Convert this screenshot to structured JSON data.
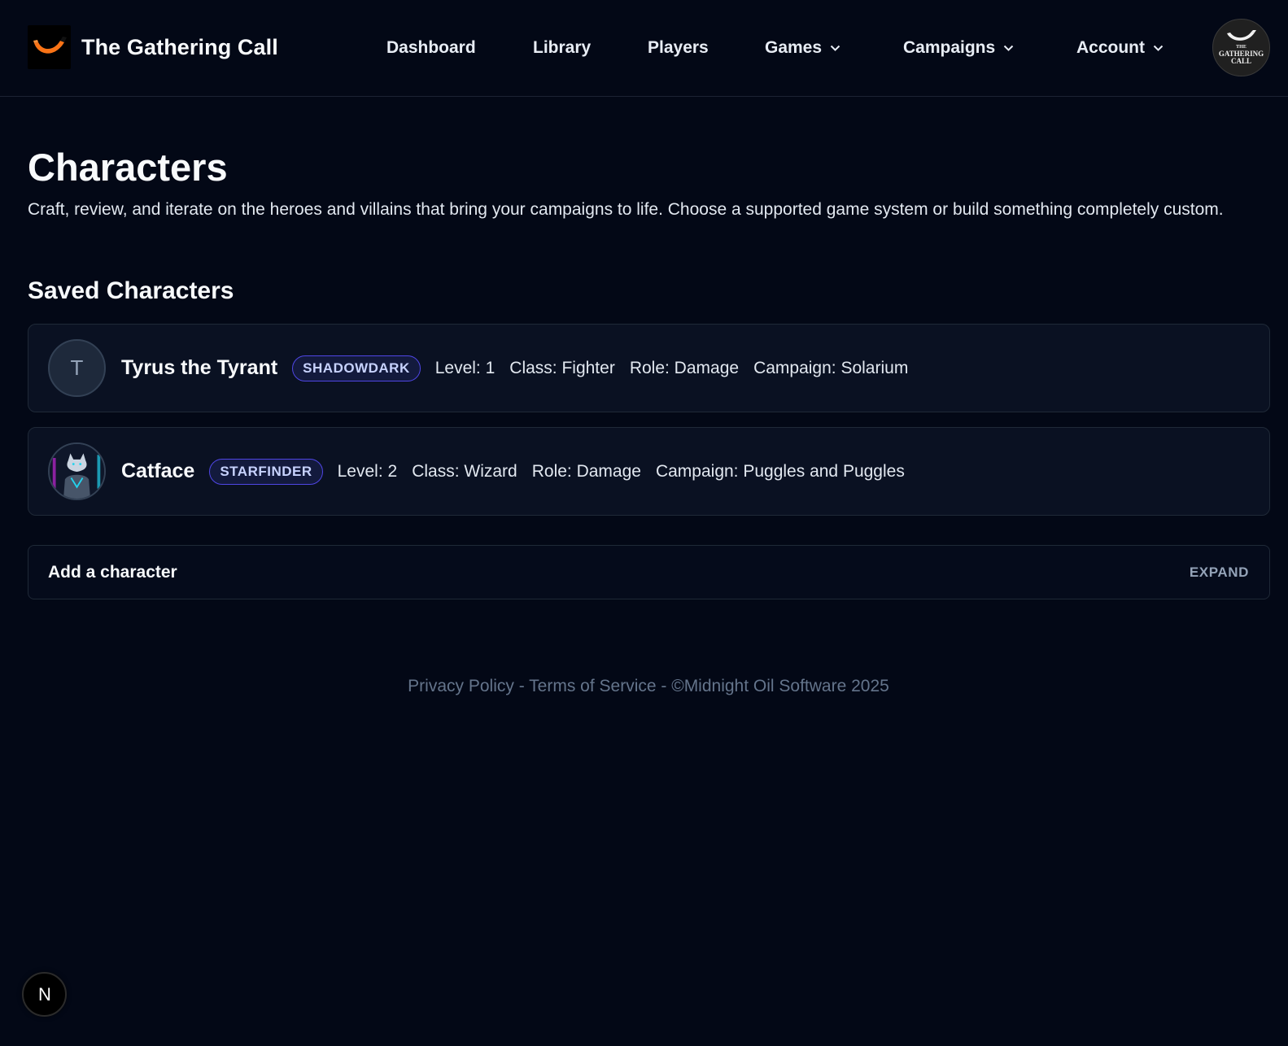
{
  "header": {
    "brand_name": "The Gathering Call",
    "nav_items": [
      {
        "label": "Dashboard"
      },
      {
        "label": "Library"
      },
      {
        "label": "Players"
      },
      {
        "label": "Games",
        "has_dropdown": true
      },
      {
        "label": "Campaigns",
        "has_dropdown": true
      },
      {
        "label": "Account",
        "has_dropdown": true
      }
    ],
    "avatar_text": [
      "THE",
      "GATHERING",
      "CALL"
    ]
  },
  "page": {
    "title": "Characters",
    "description": "Craft, review, and iterate on the heroes and villains that bring your campaigns to life. Choose a supported game system or build something completely custom.",
    "section_title": "Saved Characters"
  },
  "characters": [
    {
      "initial": "T",
      "name": "Tyrus the Tyrant",
      "system": "SHADOWDARK",
      "level": "Level: 1",
      "class": "Class: Fighter",
      "role": "Role: Damage",
      "campaign": "Campaign: Solarium"
    },
    {
      "initial": "",
      "name": "Catface",
      "system": "STARFINDER",
      "level": "Level: 2",
      "class": "Class: Wizard",
      "role": "Role: Damage",
      "campaign": "Campaign: Puggles and Puggles"
    }
  ],
  "add_panel": {
    "label": "Add a character",
    "toggle": "EXPAND"
  },
  "footer": {
    "privacy": "Privacy Policy",
    "sep1": " - ",
    "terms": "Terms of Service",
    "sep2": " - ",
    "copyright": "©Midnight Oil Software 2025"
  },
  "floating_button": {
    "label": "N"
  },
  "colors": {
    "background": "#030816",
    "card": "#0a1122",
    "badge_border": "#4f46e5",
    "brand_accent": "#f97316"
  }
}
